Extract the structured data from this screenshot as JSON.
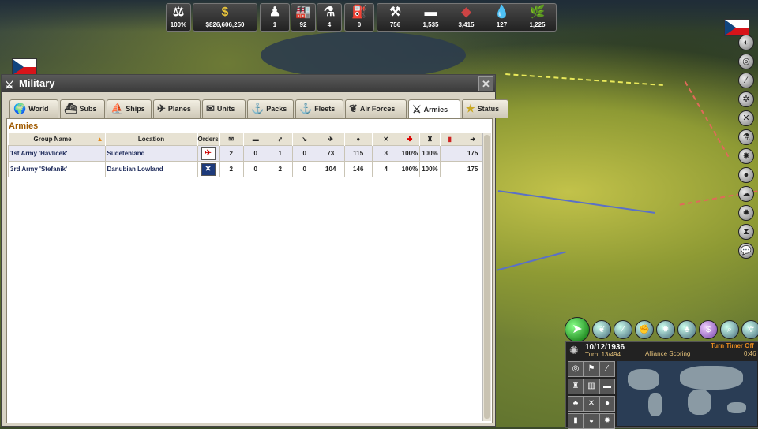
{
  "resources": {
    "stability": {
      "icon": "balance-icon",
      "value": "100%"
    },
    "money": {
      "icon": "dollar-icon",
      "value": "$826,606,250"
    },
    "diplomacy": {
      "icon": "diplomat-icon",
      "value": "1"
    },
    "industry": {
      "icon": "factory-icon",
      "value": "92"
    },
    "research": {
      "icon": "flask-icon",
      "value": "4"
    },
    "supplies": {
      "icon": "supplies-icon",
      "value": "0"
    },
    "materials": [
      {
        "icon": "mineral-icon",
        "value": "756"
      },
      {
        "icon": "steel-icon",
        "value": "1,535"
      },
      {
        "icon": "ore-icon",
        "value": "3,415"
      },
      {
        "icon": "oil-icon",
        "value": "127"
      },
      {
        "icon": "rubber-icon",
        "value": "1,225"
      }
    ]
  },
  "window": {
    "title": "Military",
    "close": "✕",
    "tabs": [
      {
        "label": "World",
        "icon": "🌍"
      },
      {
        "label": "Subs",
        "icon": "⛴"
      },
      {
        "label": "Ships",
        "icon": "🚢"
      },
      {
        "label": "Planes",
        "icon": "✈"
      },
      {
        "label": "Units",
        "icon": "✉"
      },
      {
        "label": "Packs",
        "icon": "⚓"
      },
      {
        "label": "Fleets",
        "icon": "⚓"
      },
      {
        "label": "Air Forces",
        "icon": "🦅"
      },
      {
        "label": "Armies",
        "icon": "⚔"
      },
      {
        "label": "Status",
        "icon": "★"
      }
    ],
    "active_tab": "Armies",
    "panel_title": "Armies",
    "columns": [
      "Group Name",
      "Location",
      "Orders",
      "✉",
      "▬",
      "➶",
      "↘",
      "✈",
      "●",
      "✕",
      "✚",
      "♜",
      "▮",
      "➜"
    ],
    "sort_indicator": "▲",
    "rows": [
      {
        "name": "1st Army 'Havlicek'",
        "location": "Sudetenland",
        "orders": "✈",
        "c1": "2",
        "c2": "0",
        "c3": "1",
        "c4": "0",
        "c5": "73",
        "c6": "115",
        "c7": "3",
        "c8": "100%",
        "c9": "100%",
        "c10": "",
        "c11": "175"
      },
      {
        "name": "3rd Army 'Stefanik'",
        "location": "Danubian Lowland",
        "orders": "✕",
        "c1": "2",
        "c2": "0",
        "c3": "2",
        "c4": "0",
        "c5": "104",
        "c6": "146",
        "c7": "4",
        "c8": "100%",
        "c9": "100%",
        "c10": "",
        "c11": "175"
      }
    ]
  },
  "info": {
    "date": "10/12/1936",
    "turn": "Turn: 13/494",
    "alliance": "Alliance Scoring",
    "timer": "Turn Timer Off",
    "time": "0:46"
  },
  "colors": {
    "accent_orange": "#a05a00",
    "czech_red": "#d7141a",
    "czech_blue": "#11457e"
  }
}
